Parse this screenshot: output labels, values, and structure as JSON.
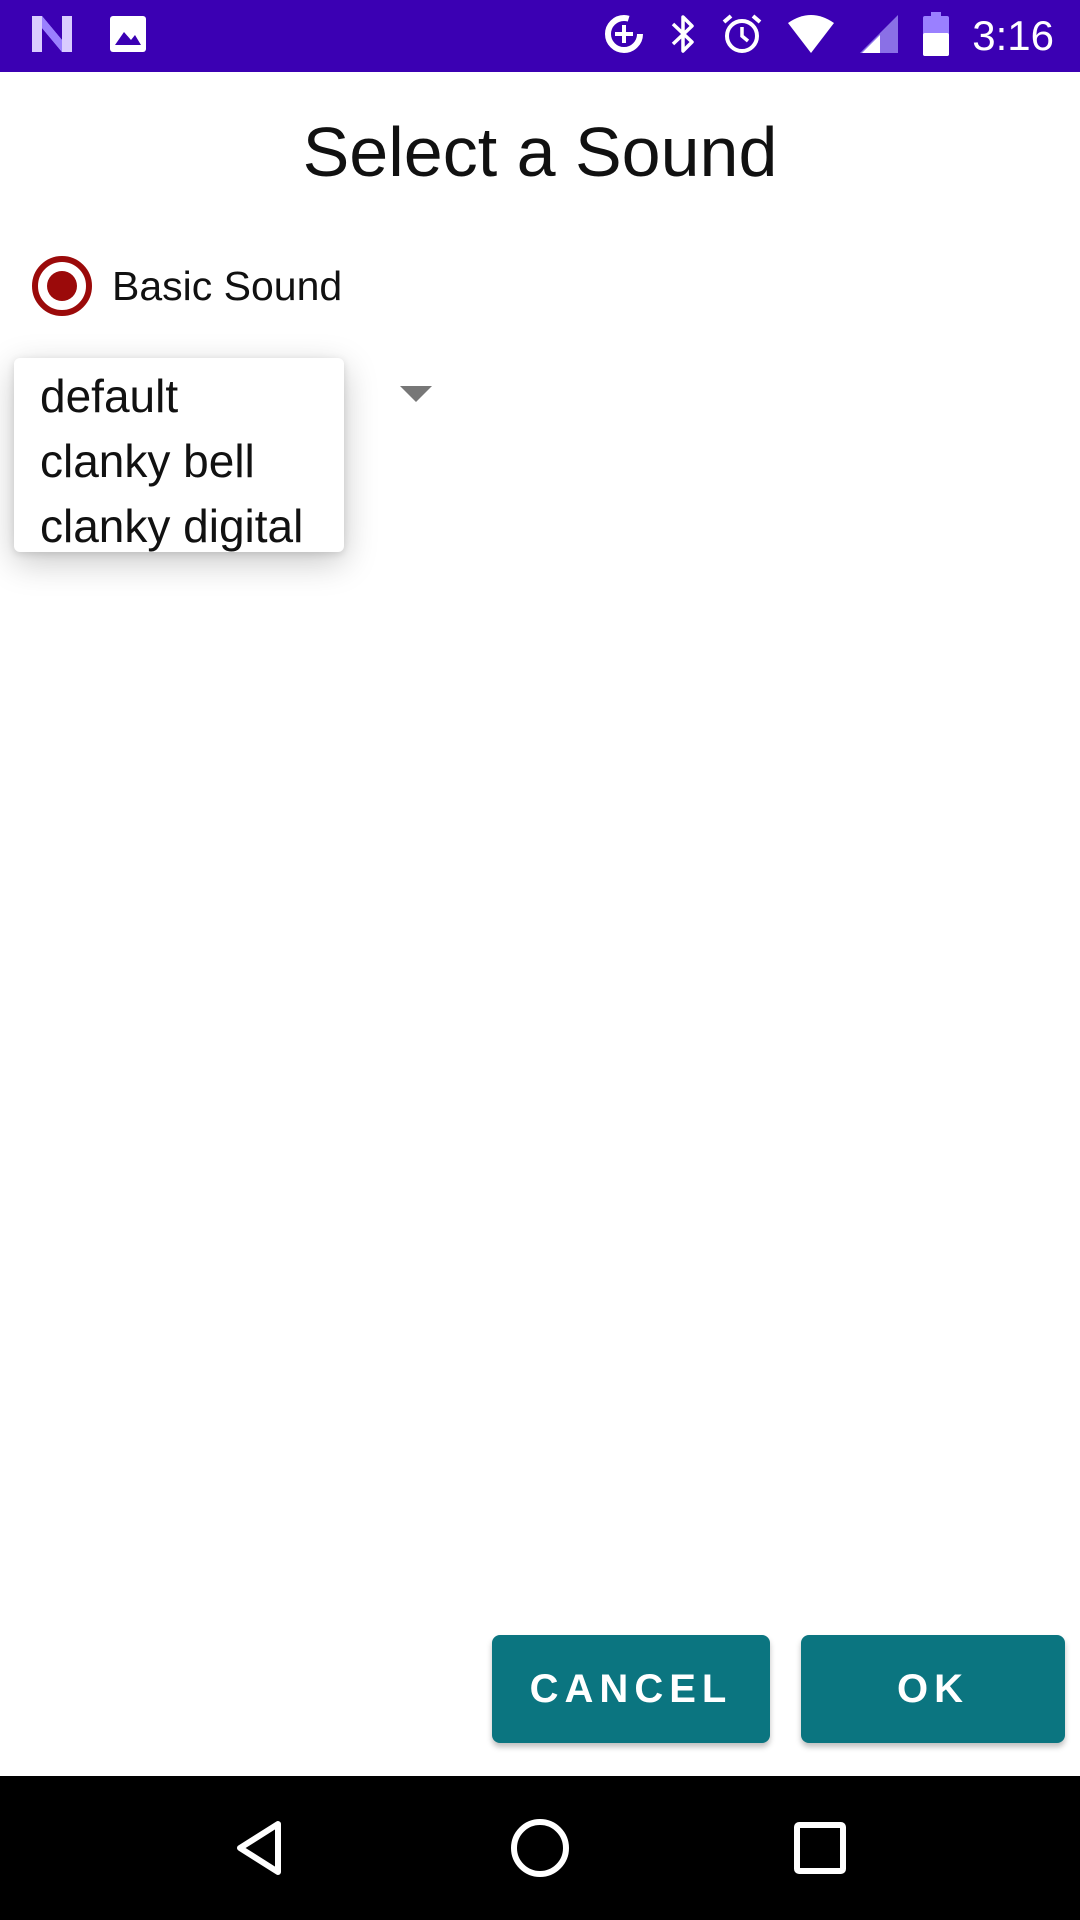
{
  "status_bar": {
    "time": "3:16",
    "background": "#3b00b3",
    "icons_left": [
      "n-logo-icon",
      "image-icon"
    ],
    "icons_right": [
      "data-saver-icon",
      "bluetooth-icon",
      "alarm-icon",
      "wifi-icon",
      "signal-icon",
      "battery-icon"
    ]
  },
  "dialog": {
    "title": "Select a Sound",
    "radio_option": {
      "label": "Basic Sound",
      "selected": true,
      "color": "#9b0a0a"
    },
    "dropdown_options": [
      "default",
      "clanky bell",
      "clanky digital"
    ],
    "buttons": {
      "cancel": "CANCEL",
      "ok": "OK",
      "color": "#0b7580"
    }
  },
  "nav_bar": {
    "icons": [
      "back-icon",
      "home-icon",
      "recents-icon"
    ]
  }
}
